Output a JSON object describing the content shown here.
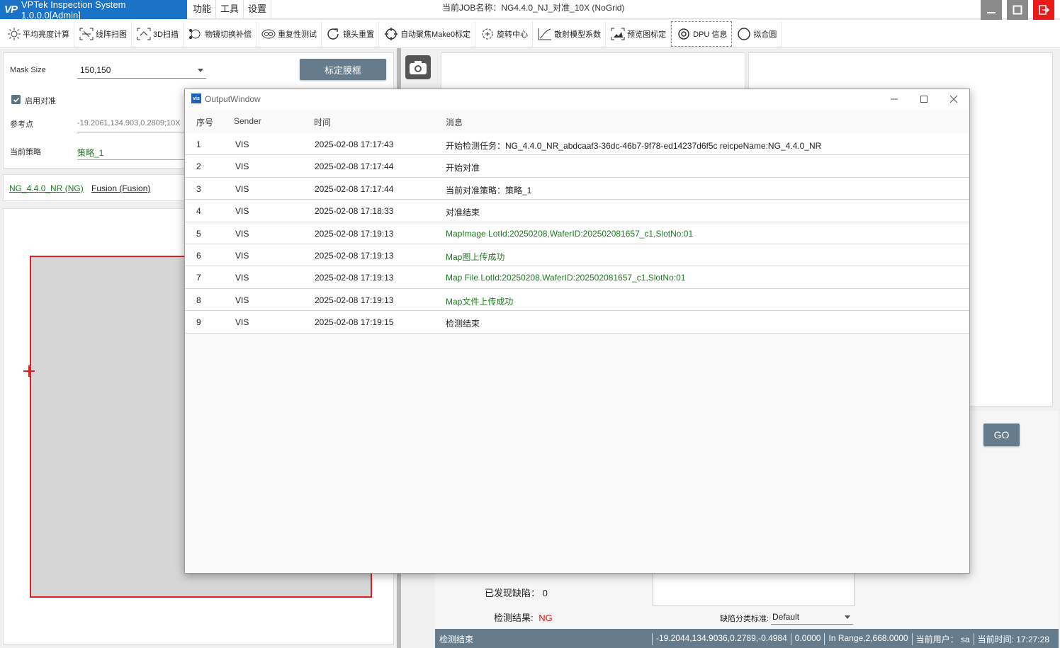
{
  "titlebar": {
    "app_name": "VPTek Inspection System 1.0.0.0[Admin]",
    "logo": "VP",
    "menu": [
      "功能",
      "工具",
      "设置"
    ],
    "job_title": "当前JOB名称：NG4.4.0_NJ_对准_10X (NoGrid)"
  },
  "toolbar": {
    "items": [
      {
        "label": "平均亮度计算",
        "icon": "brightness-icon"
      },
      {
        "label": "线阵扫图",
        "icon": "line-scan-icon"
      },
      {
        "label": "3D扫描",
        "icon": "scan-3d-icon"
      },
      {
        "label": "物镜切换补偿",
        "icon": "lens-switch-icon"
      },
      {
        "label": "重复性测试",
        "icon": "repeat-test-icon"
      },
      {
        "label": "镜头重置",
        "icon": "lens-reset-icon"
      },
      {
        "label": "自动聚焦Make0标定",
        "icon": "autofocus-icon"
      },
      {
        "label": "旋转中心",
        "icon": "rotation-center-icon"
      },
      {
        "label": "散射模型系数",
        "icon": "scatter-model-icon"
      },
      {
        "label": "预览图标定",
        "icon": "preview-calib-icon"
      },
      {
        "label": "DPU 信息",
        "icon": "dpu-info-icon"
      },
      {
        "label": "拟合圆",
        "icon": "fit-circle-icon"
      }
    ]
  },
  "left": {
    "mask_size_label": "Mask Size",
    "mask_size_value": "150,150",
    "calib_button": "标定膜框",
    "enable_align_label": "启用对准",
    "ref_point_label": "参考点",
    "ref_point_value": "-19.2061,134.903,0.2809;10X",
    "strategy_label": "当前策略",
    "strategy_value": "策略_1",
    "link1": "NG_4.4.0_NR (NG)",
    "link2": "Fusion (Fusion)"
  },
  "right": {
    "go_button": "GO",
    "found_defects": "已发现缺陷：  0",
    "result_label": "检测结果: ",
    "result_value": "NG",
    "classify_label": "缺陷分类标准:",
    "classify_value": "Default"
  },
  "statusbar": {
    "left": "检测结束",
    "coords": "-19.2044,134.9036,0.2789,-0.4984",
    "value": "0.0000",
    "range": "In Range,2,668.0000",
    "user": "当前用户： sa",
    "time": "当前时间:  17:27:28"
  },
  "output_window": {
    "title": "OutputWindow",
    "icon_text": "vis",
    "columns": [
      "序号",
      "Sender",
      "时间",
      "消息"
    ],
    "rows": [
      {
        "idx": "1",
        "sender": "VIS",
        "time": "2025-02-08 17:17:43",
        "msg": "开始检测任务：NG_4.4.0_NR_abdcaaf3-36dc-46b7-9f78-ed14237d6f5c reicpeName:NG_4.4.0_NR",
        "green": false
      },
      {
        "idx": "2",
        "sender": "VIS",
        "time": "2025-02-08 17:17:44",
        "msg": "开始对准",
        "green": false
      },
      {
        "idx": "3",
        "sender": "VIS",
        "time": "2025-02-08 17:17:44",
        "msg": "当前对准策略：策略_1",
        "green": false
      },
      {
        "idx": "4",
        "sender": "VIS",
        "time": "2025-02-08 17:18:33",
        "msg": "对准结束",
        "green": false
      },
      {
        "idx": "5",
        "sender": "VIS",
        "time": "2025-02-08 17:19:13",
        "msg": "MapImage LotId:20250208,WaferID:202502081657_c1,SlotNo:01",
        "green": true
      },
      {
        "idx": "6",
        "sender": "VIS",
        "time": "2025-02-08 17:19:13",
        "msg": "Map图上传成功",
        "green": true
      },
      {
        "idx": "7",
        "sender": "VIS",
        "time": "2025-02-08 17:19:13",
        "msg": "Map File LotId:20250208,WaferID:202502081657_c1,SlotNo:01",
        "green": true
      },
      {
        "idx": "8",
        "sender": "VIS",
        "time": "2025-02-08 17:19:13",
        "msg": "Map文件上传成功",
        "green": true
      },
      {
        "idx": "9",
        "sender": "VIS",
        "time": "2025-02-08 17:19:15",
        "msg": "检测结束",
        "green": false
      }
    ]
  },
  "colors": {
    "accent": "#667c8c",
    "brand": "#1a73c7",
    "success": "#1e7a1e",
    "error": "#e01010"
  }
}
